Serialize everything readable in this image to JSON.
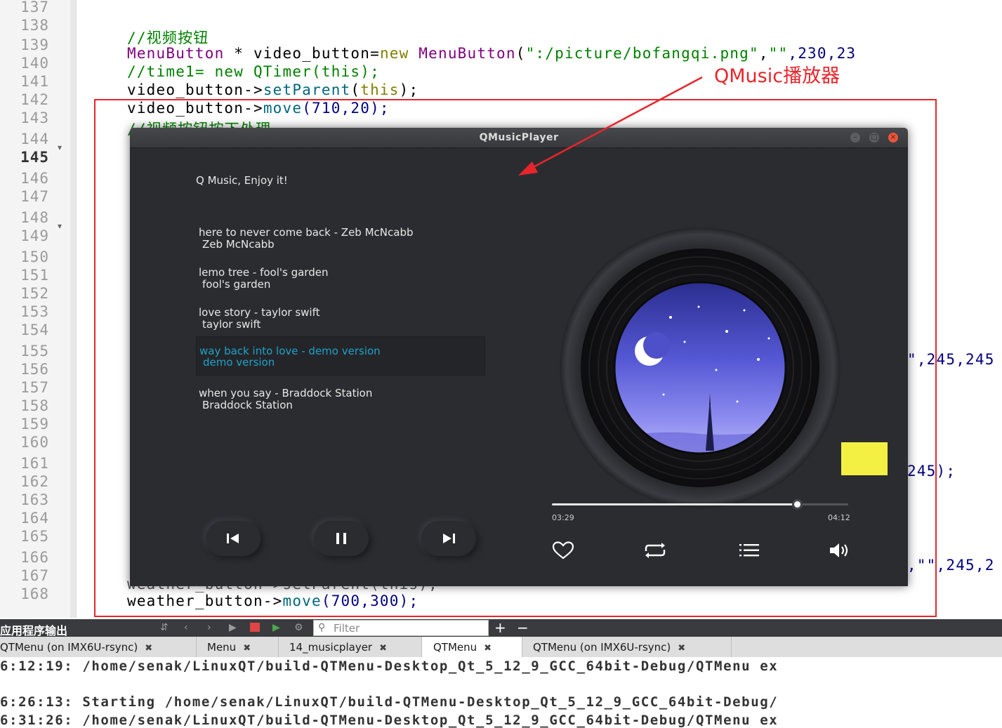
{
  "editor": {
    "line_numbers": [
      "137",
      "138",
      "139",
      "140",
      "141",
      "142",
      "143",
      "144",
      "145",
      "146",
      "147",
      "148",
      "149",
      "150",
      "151",
      "152",
      "153",
      "154",
      "155",
      "156",
      "157",
      "158",
      "159",
      "160",
      "161",
      "162",
      "163",
      "164",
      "165",
      "166",
      "167",
      "168"
    ],
    "current_line": "145",
    "code": {
      "l138_comment": "//视频按钮",
      "l139_type": "MenuButton",
      "l139_star": " * video_button=",
      "l139_new": "new",
      "l139_ctor": " MenuButton",
      "l139_paren": "(",
      "l139_str1": "\":/picture/bofangqi.png\"",
      "l139_comma": ",",
      "l139_str2": "\"\"",
      "l139_nums": ",230,23",
      "l140_comment": "//time1= new QTimer(this);",
      "l141_obj": "video_button->",
      "l141_fn": "setParent",
      "l141_open": "(",
      "l141_this": "this",
      "l141_close": ");",
      "l142_obj": "video_button->",
      "l142_fn": "move",
      "l142_args": "(710,20);",
      "l143_comment": "//视频按钮按下处理",
      "l155_tail": "\",245,245",
      "l161_tail": "245);",
      "l166_tail": ",\"\",245,2",
      "l167_partial": "weather_button->setParent(this);",
      "l168_obj": "weather_button->",
      "l168_fn": "move",
      "l168_args": "(700,300);"
    }
  },
  "annotation": {
    "label": "QMusic播放器",
    "color": "#e8252b"
  },
  "player": {
    "window_title": "QMusicPlayer",
    "slogan": "Q Music,  Enjoy it!",
    "songs": [
      {
        "title": "here to never come back - Zeb McNcabb",
        "artist": "Zeb McNcabb",
        "active": false
      },
      {
        "title": "lemo tree - fool's garden",
        "artist": "fool's garden",
        "active": false
      },
      {
        "title": "love story - taylor swift",
        "artist": "taylor swift",
        "active": false
      },
      {
        "title": "way back into love - demo version",
        "artist": "demo version",
        "active": true
      },
      {
        "title": "when you say - Braddock Station",
        "artist": "Braddock Station",
        "active": false
      }
    ],
    "current_time": "03:29",
    "total_time": "04:12",
    "progress_fraction": 0.828,
    "accent_color": "#1fa3c9",
    "controls": [
      "previous-icon",
      "pause-icon",
      "next-icon"
    ],
    "tools": [
      "heart-icon",
      "repeat-icon",
      "playlist-icon",
      "volume-icon"
    ]
  },
  "output_panel": {
    "title": "应用程序输出",
    "filter_placeholder": "Filter",
    "plus": "+",
    "minus": "−",
    "tabs": [
      {
        "label": "QTMenu (on IMX6U-rsync)",
        "selected": false
      },
      {
        "label": "Menu",
        "selected": false
      },
      {
        "label": "14_musicplayer",
        "selected": false
      },
      {
        "label": "QTMenu",
        "selected": true
      },
      {
        "label": "QTMenu (on IMX6U-rsync)",
        "selected": false
      }
    ],
    "tab_close": "✖",
    "lines": [
      "6:12:19: /home/senak/LinuxQT/build-QTMenu-Desktop_Qt_5_12_9_GCC_64bit-Debug/QTMenu ex",
      "6:26:13: Starting /home/senak/LinuxQT/build-QTMenu-Desktop_Qt_5_12_9_GCC_64bit-Debug/",
      "6:31:26: /home/senak/LinuxQT/build-QTMenu-Desktop_Qt_5_12_9_GCC_64bit-Debug/QTMenu ex"
    ]
  }
}
